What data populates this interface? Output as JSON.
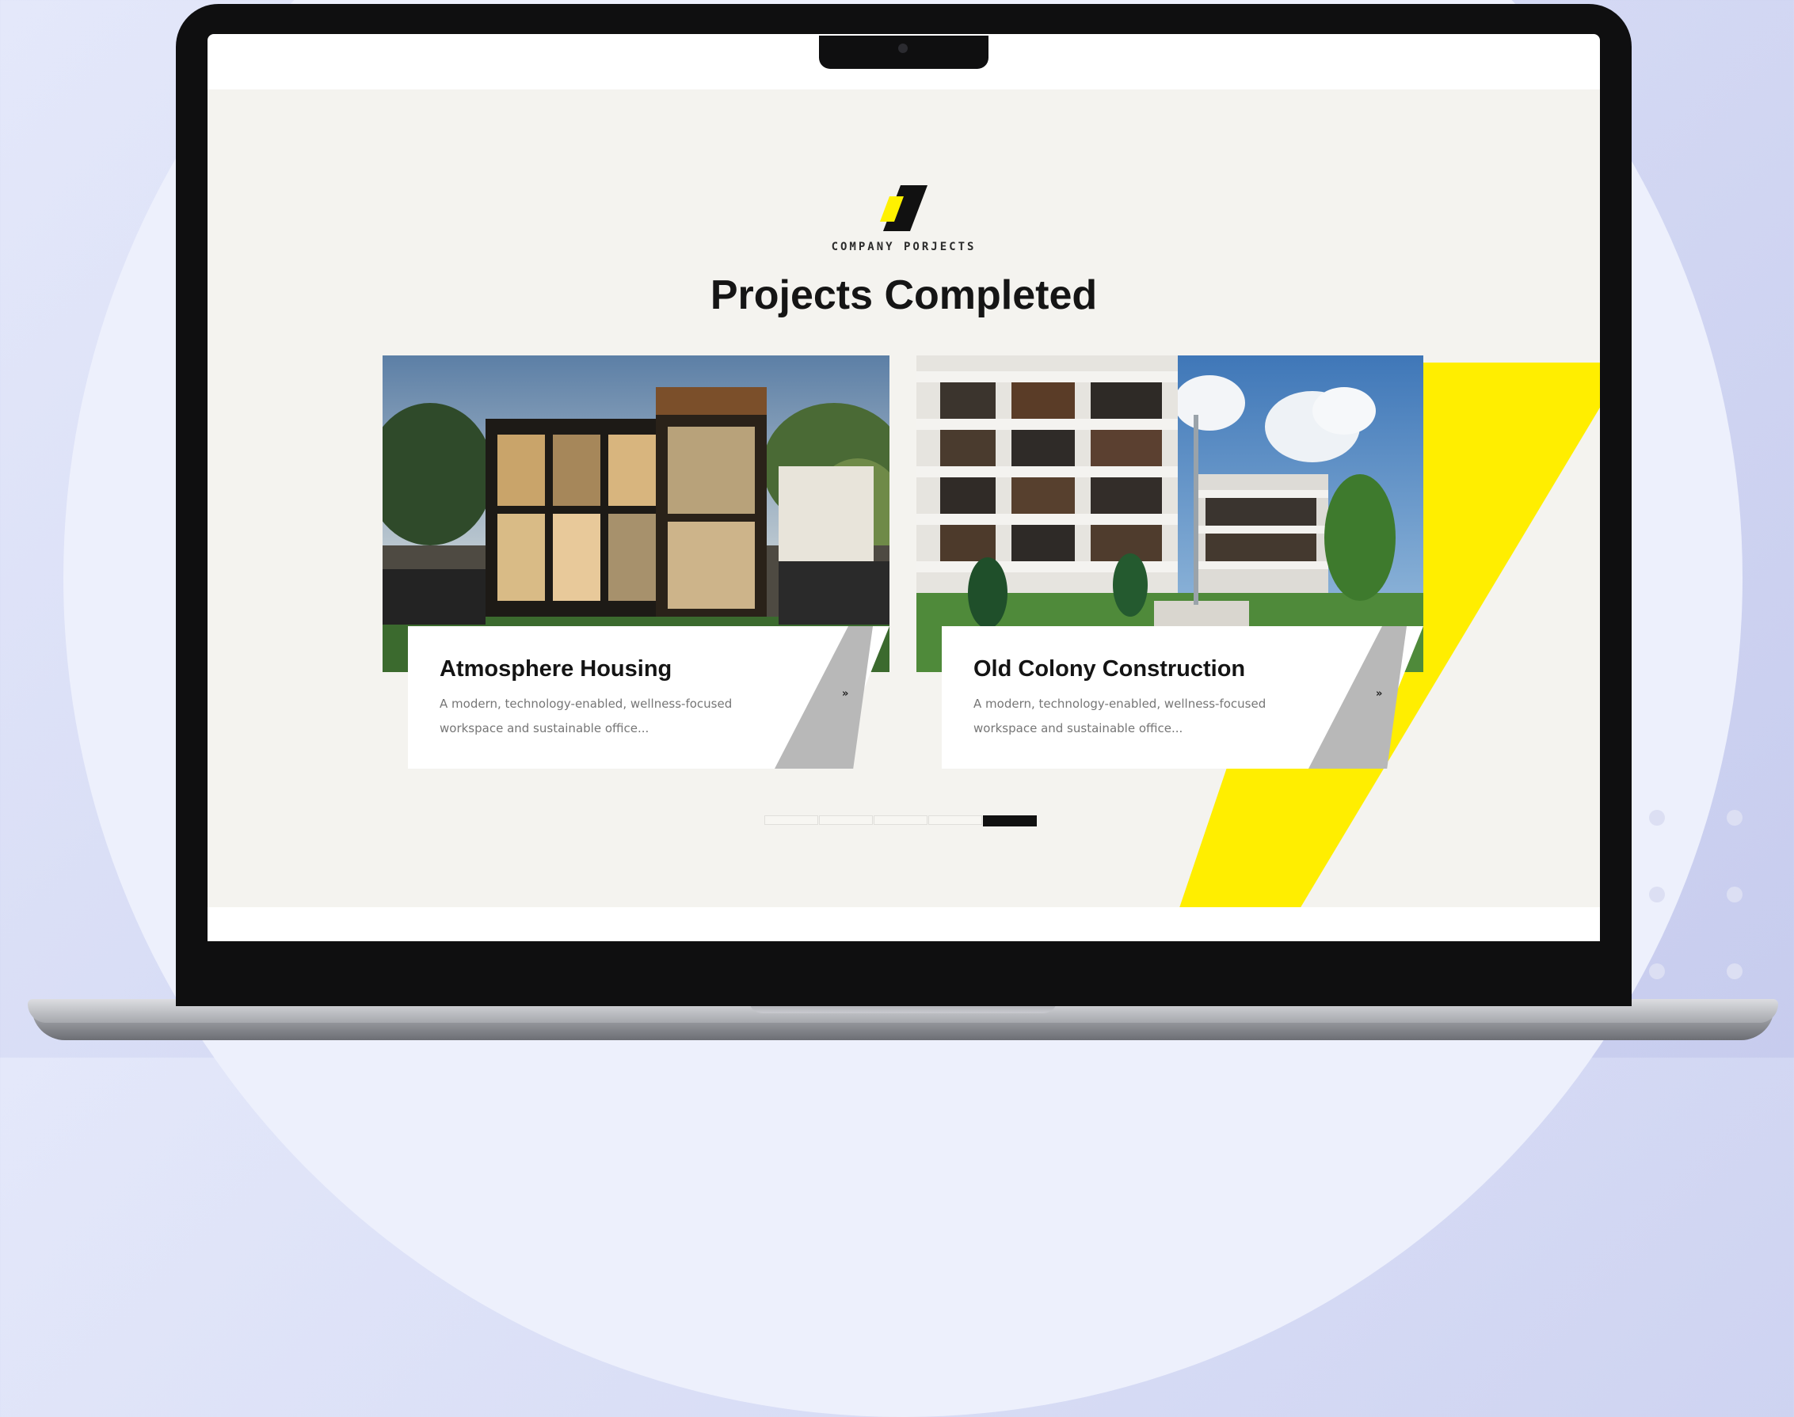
{
  "colors": {
    "accent_yellow": "#fff100",
    "page_background": "#f4f3ef",
    "heading": "#151515",
    "card_accent_gray": "#b8b8b8",
    "bezel": "#0f0f10"
  },
  "hero": {
    "logo_icon": "company-logo-icon",
    "eyebrow": "COMPANY PORJECTS",
    "title": "Projects Completed"
  },
  "projects": [
    {
      "title": "Atmosphere Housing",
      "description": "A modern, technology-enabled, wellness-focused workspace and sustainable office...",
      "arrow_icon": "arrow-right-icon",
      "image": "modern-house-photo"
    },
    {
      "title": "Old Colony Construction",
      "description": "A modern, technology-enabled, wellness-focused workspace and sustainable office...",
      "arrow_icon": "arrow-right-icon",
      "image": "apartment-building-photo"
    }
  ],
  "pagination": {
    "total": 5,
    "active_index": 5
  }
}
